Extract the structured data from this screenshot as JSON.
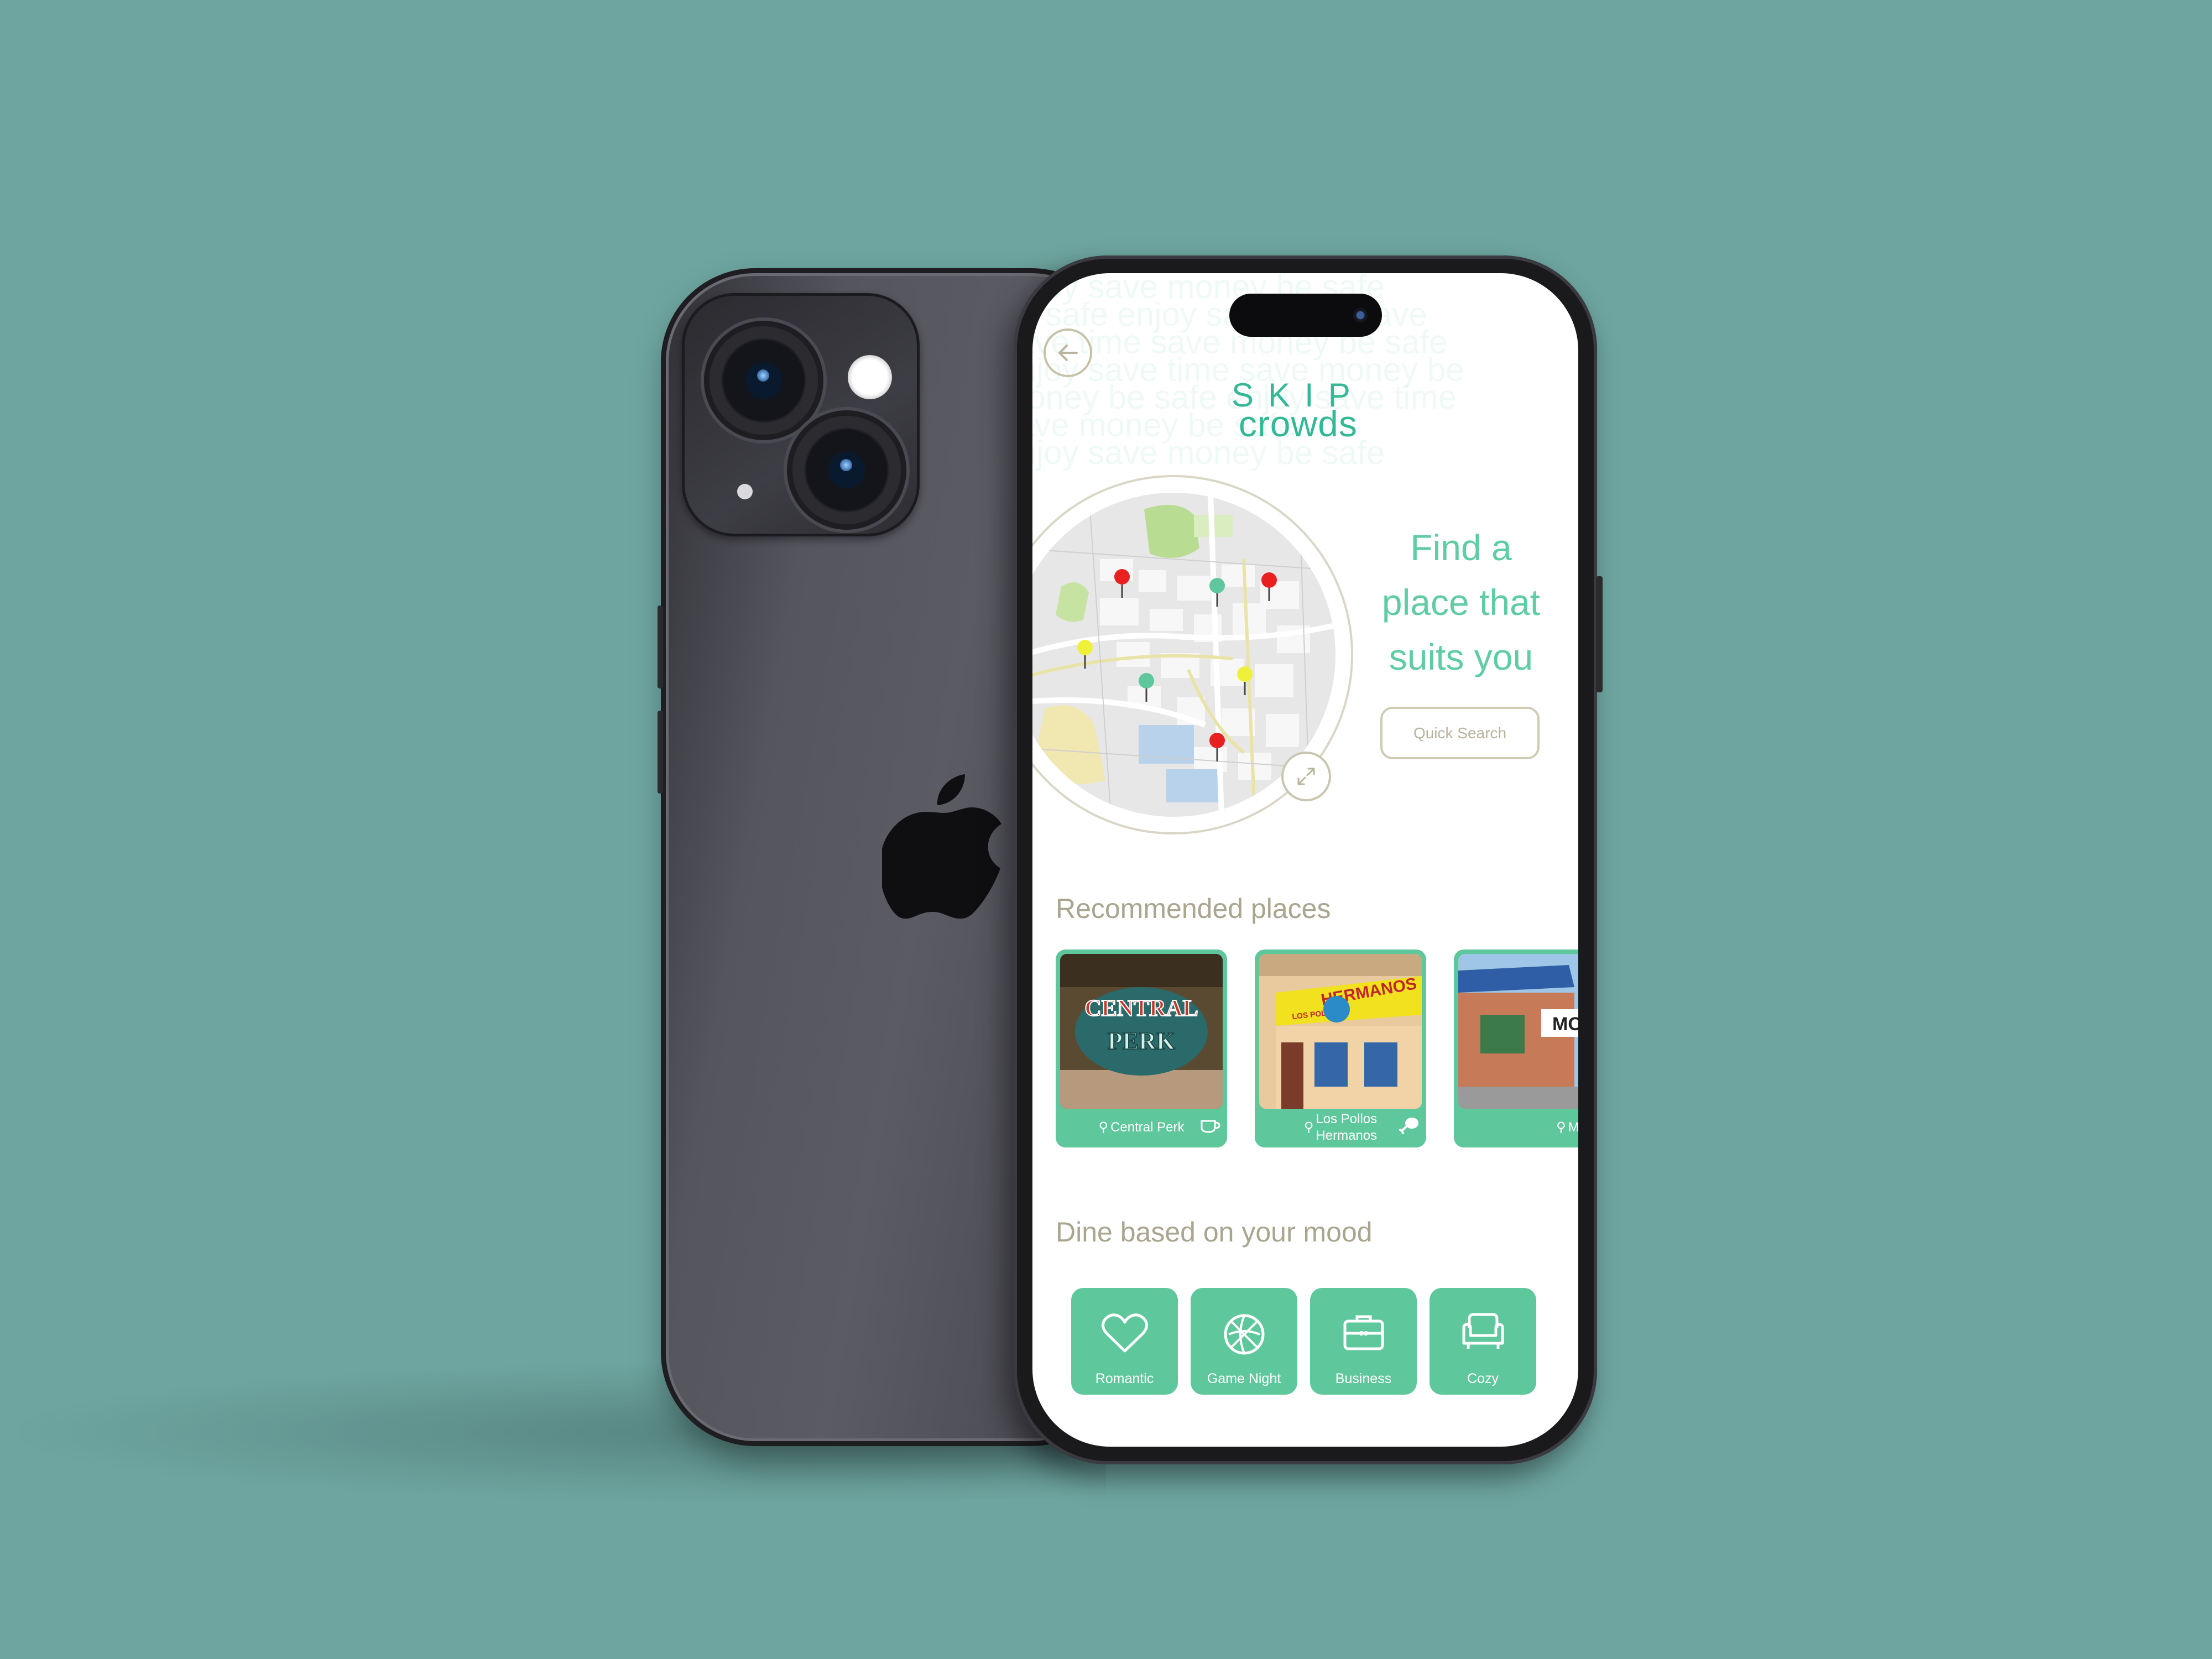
{
  "app": {
    "logo_top": "SKIP",
    "logo_bottom": "crowds",
    "background_words": [
      "enjoy save money be safe",
      "be safe enjoy save time save",
      "save time save money be safe",
      "enjoy save time save money be",
      "money be safe enjoy save time",
      "save money be safe"
    ]
  },
  "hero": {
    "tagline_lines": [
      "Find a",
      "place that",
      "suits you"
    ],
    "quick_search_label": "Quick Search"
  },
  "map": {
    "pin_colors": {
      "busy": "#e8201f",
      "moderate": "#eef03a",
      "quiet": "#5ec79b"
    }
  },
  "recommended": {
    "title": "Recommended places",
    "places": [
      {
        "name": "Central Perk",
        "icon": "coffee-cup-icon"
      },
      {
        "name": "Los Pollos Hermanos",
        "name_line1": "Los Pollos",
        "name_line2": "Hermanos",
        "icon": "chicken-leg-icon"
      },
      {
        "name": "Moe's",
        "icon": ""
      }
    ],
    "signs": {
      "central_perk_top": "CENTRAL",
      "central_perk_bottom": "PERK",
      "los_pollos_big": "HERMANOS",
      "los_pollos_small": "LOS POLLOS",
      "moes": "MO"
    }
  },
  "mood": {
    "title": "Dine based on your mood",
    "options": [
      {
        "label": "Romantic",
        "icon": "heart-icon"
      },
      {
        "label": "Game Night",
        "icon": "basketball-icon"
      },
      {
        "label": "Business",
        "icon": "briefcase-icon"
      },
      {
        "label": "Cozy",
        "icon": "armchair-icon"
      }
    ]
  },
  "colors": {
    "background": "#6ea5a0",
    "accent_green": "#5ec79b",
    "logo_teal": "#34b896",
    "muted_text": "#a9a58e"
  }
}
